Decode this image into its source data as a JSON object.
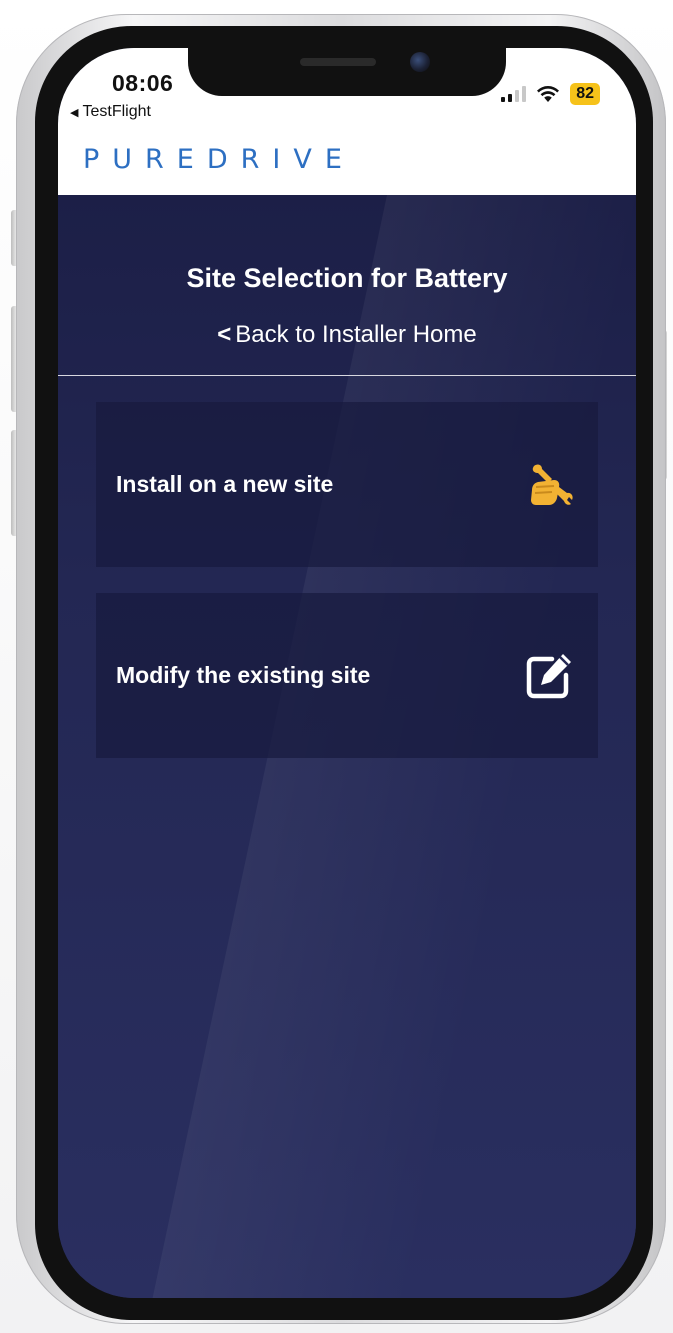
{
  "status_bar": {
    "time": "08:06",
    "back_app": "TestFlight",
    "battery": "82"
  },
  "brand": {
    "logo_text": "PUREDRIVE",
    "accent_color": "#2d6fc2"
  },
  "page": {
    "title": "Site Selection for Battery",
    "back_link": "Back to Installer Home"
  },
  "options": [
    {
      "label": "Install on a new site",
      "icon": "hand-wrench-icon",
      "icon_color": "#f2b233"
    },
    {
      "label": "Modify the existing site",
      "icon": "edit-icon",
      "icon_color": "#ffffff"
    }
  ]
}
